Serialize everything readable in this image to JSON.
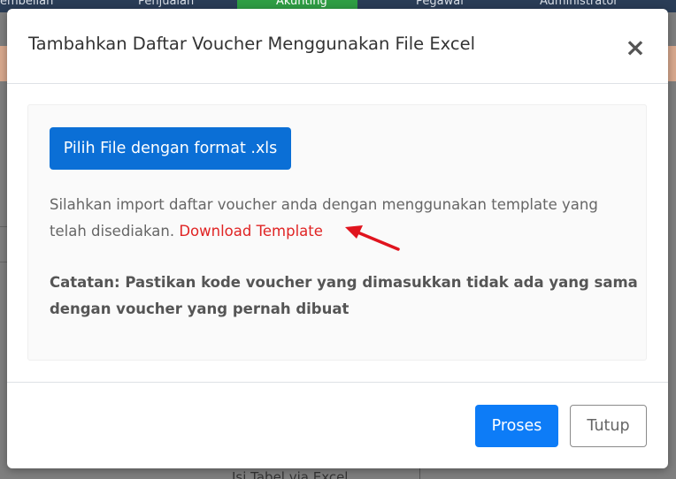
{
  "background": {
    "nav_items": [
      "embelian",
      "Penjualan",
      "Akunting",
      "Pegawai",
      "Administrator"
    ],
    "footer_text": "Isi Tabel via Excel"
  },
  "modal": {
    "title": "Tambahkan Daftar Voucher Menggunakan File Excel",
    "close_label": "×",
    "pick_file_label": "Pilih File dengan format .xls",
    "info_text": "Silahkan import daftar voucher anda dengan menggunakan template yang telah disediakan.",
    "download_link": "Download Template",
    "note": "Catatan: Pastikan kode voucher yang dimasukkan tidak ada yang sama dengan voucher yang pernah dibuat",
    "proses_label": "Proses",
    "tutup_label": "Tutup"
  },
  "colors": {
    "primary": "#0d7cf7",
    "link": "#e02424",
    "arrow": "#e0141e"
  }
}
